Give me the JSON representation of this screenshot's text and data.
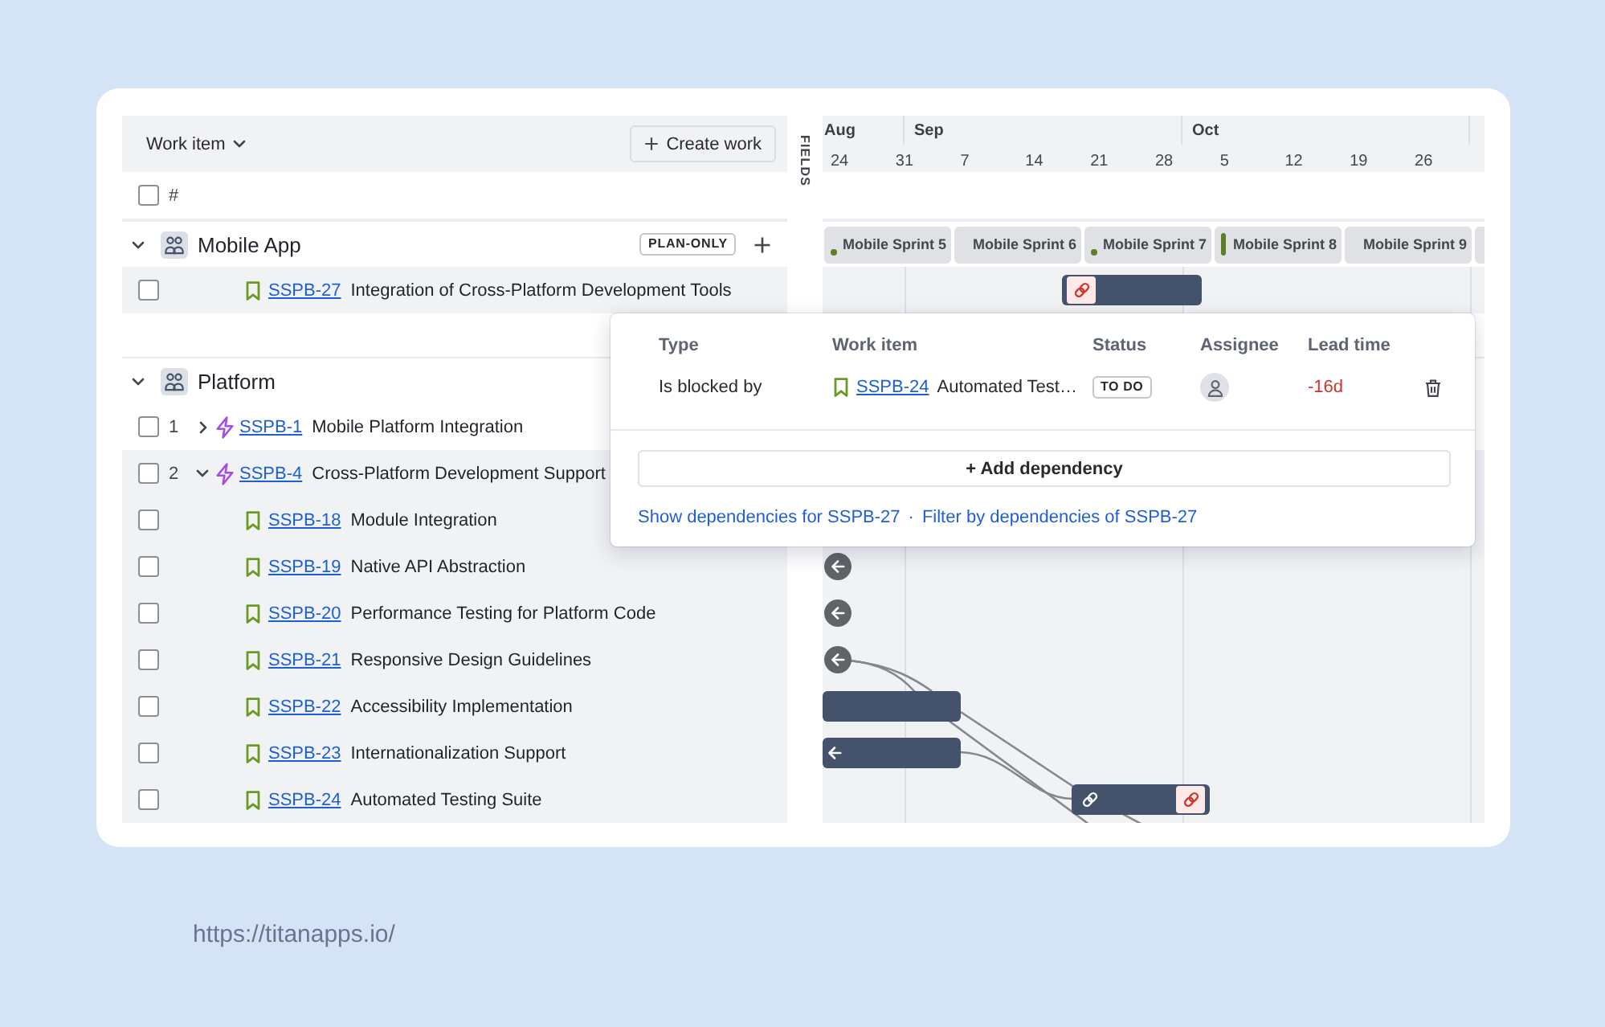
{
  "toolbar": {
    "column_menu": "Work item",
    "create_button": "Create work"
  },
  "fields_tab": "FIELDS",
  "list_header": {
    "checked": false,
    "number_heading": "#"
  },
  "timeline_header": {
    "months": [
      "Aug",
      "Sep",
      "Oct"
    ],
    "weeks": [
      "24",
      "31",
      "7",
      "14",
      "21",
      "28",
      "5",
      "12",
      "19",
      "26"
    ]
  },
  "groups": [
    {
      "name": "Mobile App",
      "expanded": true,
      "tag": "PLAN-ONLY",
      "can_add": true,
      "sprints": [
        {
          "name": "Mobile Sprint 5",
          "dot": true,
          "current": false
        },
        {
          "name": "Mobile Sprint 6",
          "dot": false,
          "current": false
        },
        {
          "name": "Mobile Sprint 7",
          "dot": true,
          "current": false
        },
        {
          "name": "Mobile Sprint 8",
          "dot": false,
          "current": true
        },
        {
          "name": "Mobile Sprint 9",
          "dot": false,
          "current": false
        },
        {
          "dot": false,
          "current": false
        }
      ],
      "items": [
        {
          "kind": "story",
          "key": "SSPB-27",
          "title": "Integration of Cross-Platform Development Tools",
          "checked": false,
          "highlighted": true,
          "timeline": {
            "kind": "bar",
            "continues_left": false,
            "linked": false,
            "conflict_start": true,
            "conflict_end": false
          }
        }
      ]
    },
    {
      "name": "Platform",
      "expanded": true,
      "items": [
        {
          "kind": "epic",
          "number": "1",
          "key": "SSPB-1",
          "title": "Mobile Platform Integration",
          "checked": false,
          "highlighted": false,
          "expanded": false
        },
        {
          "kind": "epic",
          "number": "2",
          "key": "SSPB-4",
          "title": "Cross-Platform Development Support",
          "checked": false,
          "highlighted": true,
          "expanded": true,
          "children": [
            {
              "kind": "story",
              "key": "SSPB-18",
              "title": "Module Integration",
              "checked": false,
              "highlighted": true
            },
            {
              "kind": "story",
              "key": "SSPB-19",
              "title": "Native API Abstraction",
              "checked": false,
              "highlighted": true,
              "timeline": {
                "kind": "offscreen"
              }
            },
            {
              "kind": "story",
              "key": "SSPB-20",
              "title": "Performance Testing for Platform Code",
              "checked": false,
              "highlighted": true,
              "timeline": {
                "kind": "offscreen"
              }
            },
            {
              "kind": "story",
              "key": "SSPB-21",
              "title": "Responsive Design Guidelines",
              "checked": false,
              "highlighted": true,
              "timeline": {
                "kind": "offscreen"
              }
            },
            {
              "kind": "story",
              "key": "SSPB-22",
              "title": "Accessibility Implementation",
              "checked": false,
              "highlighted": true,
              "timeline": {
                "kind": "bar",
                "continues_left": false,
                "linked": false,
                "conflict_start": false,
                "conflict_end": false
              }
            },
            {
              "kind": "story",
              "key": "SSPB-23",
              "title": "Internationalization Support",
              "checked": false,
              "highlighted": true,
              "timeline": {
                "kind": "bar",
                "continues_left": true,
                "linked": false,
                "conflict_start": false,
                "conflict_end": false
              }
            },
            {
              "kind": "story",
              "key": "SSPB-24",
              "title": "Automated Testing Suite",
              "checked": false,
              "highlighted": true,
              "timeline": {
                "kind": "bar",
                "continues_left": false,
                "linked": true,
                "conflict_start": false,
                "conflict_end": true
              }
            }
          ]
        }
      ]
    }
  ],
  "dependency_popup": {
    "columns": [
      "Type",
      "Work item",
      "Status",
      "Assignee",
      "Lead time"
    ],
    "rows": [
      {
        "type": "Is blocked by",
        "kind": "story",
        "key": "SSPB-24",
        "title": "Automated Test…",
        "status": "TO DO",
        "lead_time": "-16d",
        "negative": true
      }
    ],
    "add_button": "+ Add dependency",
    "links": [
      "Show dependencies for SSPB-27",
      "Filter by dependencies of SSPB-27"
    ],
    "separator": "·"
  },
  "footer": {
    "url": "https://titanapps.io/"
  }
}
